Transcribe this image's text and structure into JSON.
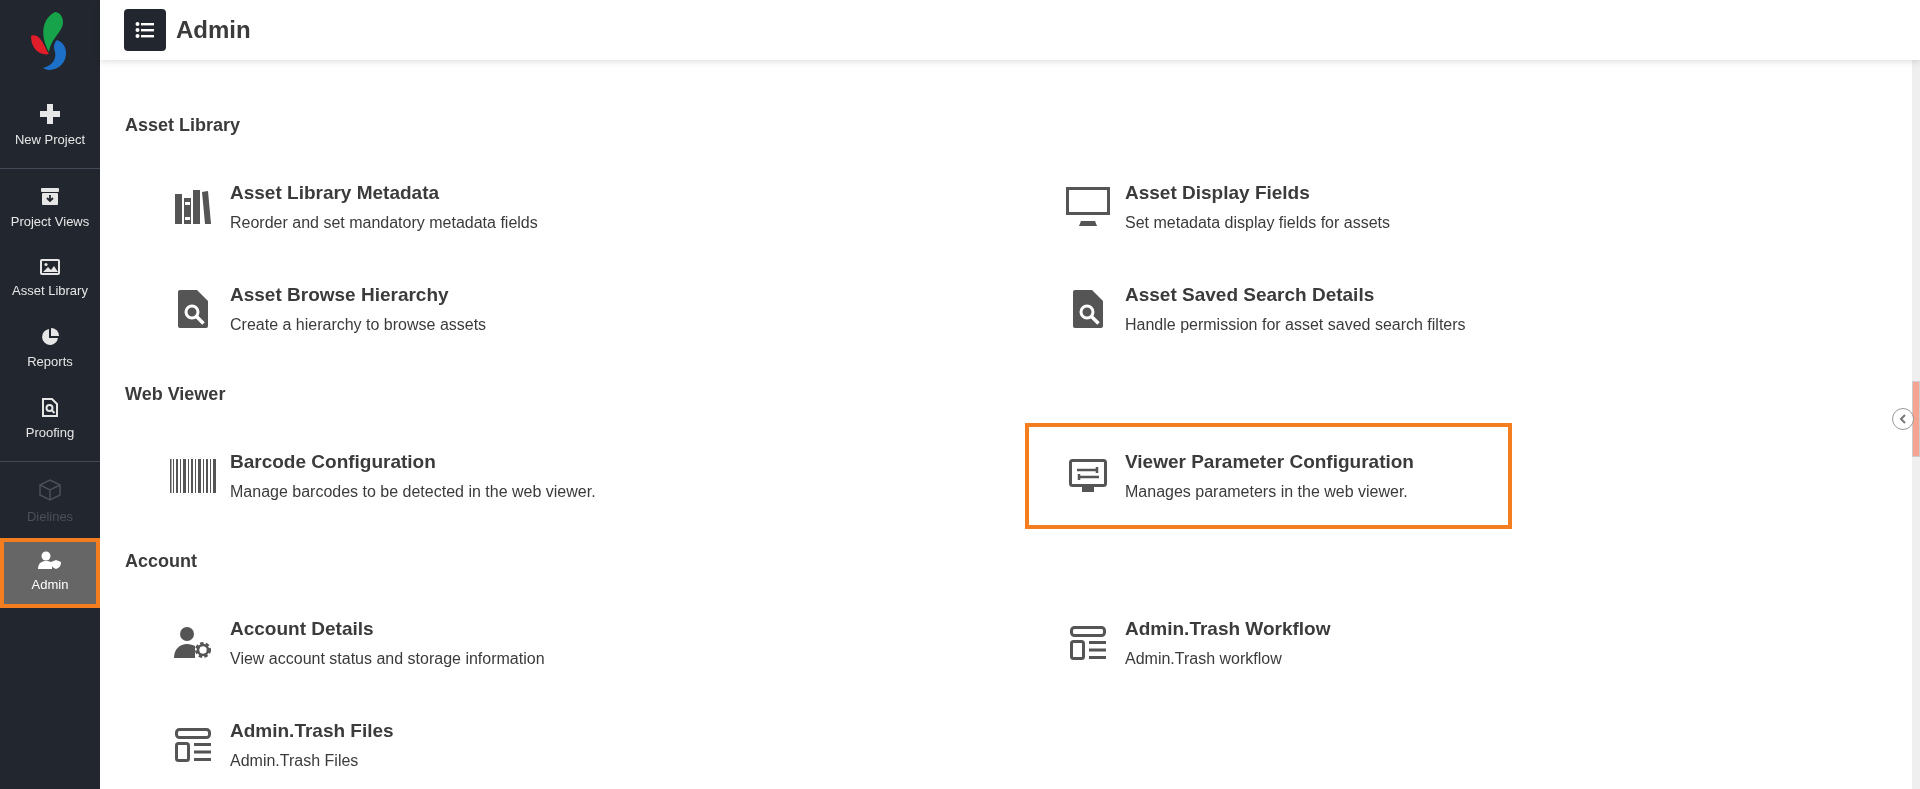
{
  "sidebar": {
    "items": [
      {
        "label": "New Project",
        "selected": false,
        "disabled": false,
        "highlighted": false
      },
      {
        "label": "Project Views",
        "selected": false,
        "disabled": false,
        "highlighted": false
      },
      {
        "label": "Asset Library",
        "selected": false,
        "disabled": false,
        "highlighted": false
      },
      {
        "label": "Reports",
        "selected": false,
        "disabled": false,
        "highlighted": false
      },
      {
        "label": "Proofing",
        "selected": false,
        "disabled": false,
        "highlighted": false
      },
      {
        "label": "Dielines",
        "selected": false,
        "disabled": true,
        "highlighted": false
      },
      {
        "label": "Admin",
        "selected": true,
        "disabled": false,
        "highlighted": true
      }
    ]
  },
  "header": {
    "title": "Admin"
  },
  "sections": [
    {
      "title": "Asset Library",
      "items": [
        {
          "title": "Asset Library Metadata",
          "description": "Reorder and set mandatory metadata fields",
          "highlighted": false
        },
        {
          "title": "Asset Display Fields",
          "description": "Set metadata display fields for assets",
          "highlighted": false
        },
        {
          "title": "Asset Browse Hierarchy",
          "description": "Create a hierarchy to browse assets",
          "highlighted": false
        },
        {
          "title": "Asset Saved Search Details",
          "description": "Handle permission for asset saved search filters",
          "highlighted": false
        }
      ]
    },
    {
      "title": "Web Viewer",
      "items": [
        {
          "title": "Barcode Configuration",
          "description": "Manage barcodes to be detected in the web viewer.",
          "highlighted": false
        },
        {
          "title": "Viewer Parameter Configuration",
          "description": "Manages parameters in the web viewer.",
          "highlighted": true
        }
      ]
    },
    {
      "title": "Account",
      "items": [
        {
          "title": "Account Details",
          "description": "View account status and storage information",
          "highlighted": false
        },
        {
          "title": "Admin.Trash Workflow",
          "description": "Admin.Trash workflow",
          "highlighted": false
        },
        {
          "title": "Admin.Trash Files",
          "description": "Admin.Trash Files",
          "highlighted": false
        }
      ]
    }
  ]
}
